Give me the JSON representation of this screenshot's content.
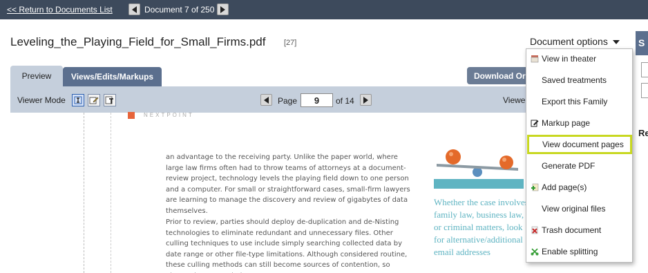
{
  "topbar": {
    "return_label": "<< Return to Documents List",
    "doc_counter": "Document 7 of 250"
  },
  "document": {
    "title": "Leveling_the_Playing_Field_for_Small_Firms.pdf",
    "count": "[27]"
  },
  "tabs": {
    "preview": "Preview",
    "views": "Views/Edits/Markups"
  },
  "download_label": "Download Original",
  "viewer": {
    "mode_label": "Viewer Mode",
    "page_label": "Page",
    "page_value": "9",
    "page_of": "of 14",
    "cut_label": "Viewer"
  },
  "preview": {
    "logo_text": "NEXTPOINT",
    "paragraph1": "an advantage to the receiving party. Unlike the paper world, where large law firms often had to throw teams of attorneys at a document-review project, technology levels the playing field down to one person and a computer. For small or straightforward cases, small-firm lawyers are learning to manage the discovery and review of gigabytes of data themselves.",
    "paragraph2": "Prior to review, parties should deploy de-duplication and de-Nisting technologies to eliminate redundant and unnecessary files. Other culling techniques to use include simply searching collected data by date range or other file-type limitations. Although considered routine, these culling methods can still become sources of contention, so always document their use.",
    "pull_quote": "Whether the case involves family law, business law, or criminal matters, look for alternative/additional email addresses"
  },
  "doc_options": {
    "label": "Document options",
    "items": [
      {
        "label": "View in theater",
        "icon": "theater-icon"
      },
      {
        "label": "Saved treatments",
        "icon": ""
      },
      {
        "label": "Export this Family",
        "icon": ""
      },
      {
        "label": "Markup page",
        "icon": "pencil-icon"
      },
      {
        "label": "View document pages",
        "icon": "",
        "highlighted": true
      },
      {
        "label": "Generate PDF",
        "icon": ""
      },
      {
        "label": "Add page(s)",
        "icon": "add-page-icon"
      },
      {
        "label": "View original files",
        "icon": ""
      },
      {
        "label": "Trash document",
        "icon": "trash-icon"
      },
      {
        "label": "Enable splitting",
        "icon": "split-icon"
      }
    ]
  },
  "right_panel": {
    "head_letter": "S",
    "r_letter": "Re"
  },
  "colors": {
    "topbar": "#3d4a5c",
    "tab_active": "#c5cfdc",
    "tab_inactive": "#5b6f8e",
    "highlight": "#c8d820",
    "pull_quote": "#5fb4c2",
    "logo": "#e7643a"
  }
}
